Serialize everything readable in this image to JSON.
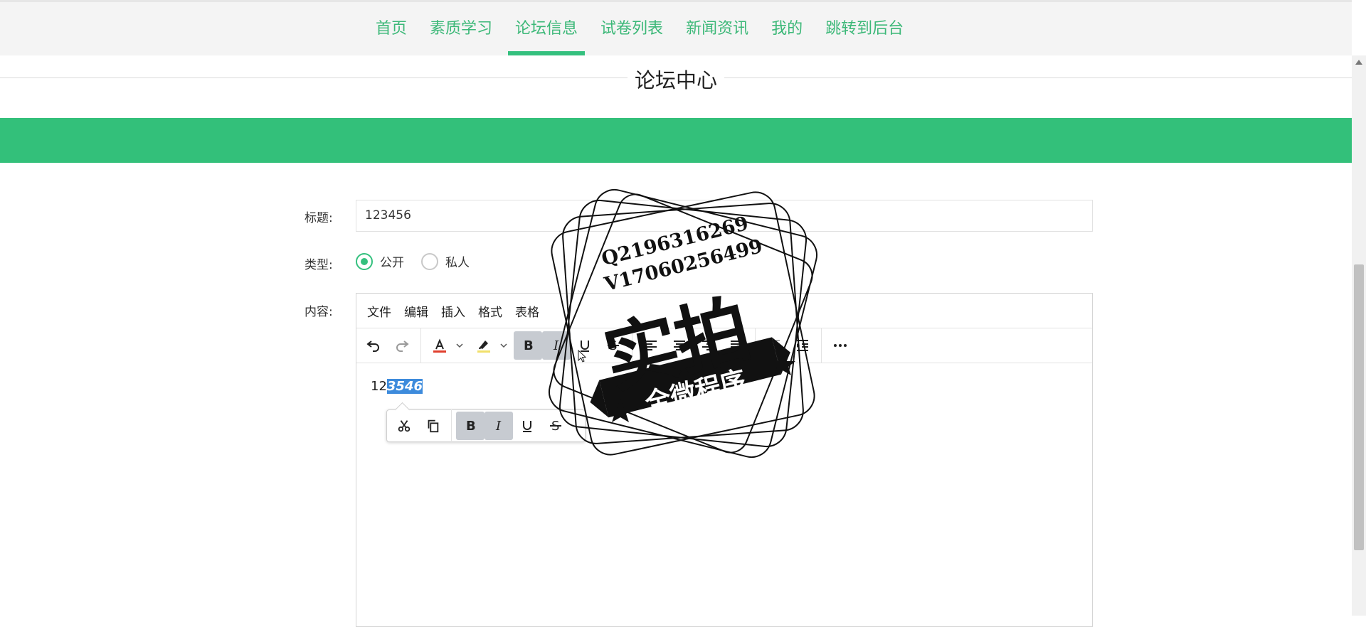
{
  "nav": {
    "items": [
      {
        "label": "首页"
      },
      {
        "label": "素质学习"
      },
      {
        "label": "论坛信息"
      },
      {
        "label": "试卷列表"
      },
      {
        "label": "新闻资讯"
      },
      {
        "label": "我的"
      },
      {
        "label": "跳转到后台"
      }
    ],
    "active_index": 2
  },
  "page": {
    "title": "论坛中心"
  },
  "form": {
    "title_label": "标题:",
    "title_value": "123456",
    "type_label": "类型:",
    "type_options": [
      {
        "label": "公开",
        "checked": true
      },
      {
        "label": "私人",
        "checked": false
      }
    ],
    "content_label": "内容:"
  },
  "editor": {
    "menus": [
      "文件",
      "编辑",
      "插入",
      "格式",
      "表格"
    ],
    "content_plain": "12",
    "content_selected": "3546"
  },
  "watermark": {
    "line1": "Q2196316269",
    "line2": "V17060256499",
    "big": "实拍",
    "ribbon": "全微程序"
  },
  "colors": {
    "accent": "#34c07e",
    "nav_text": "#3cb878",
    "selection": "#3d8bdc",
    "font_color_swatch": "#e03e2d",
    "highlight_swatch": "#f1e06b"
  }
}
